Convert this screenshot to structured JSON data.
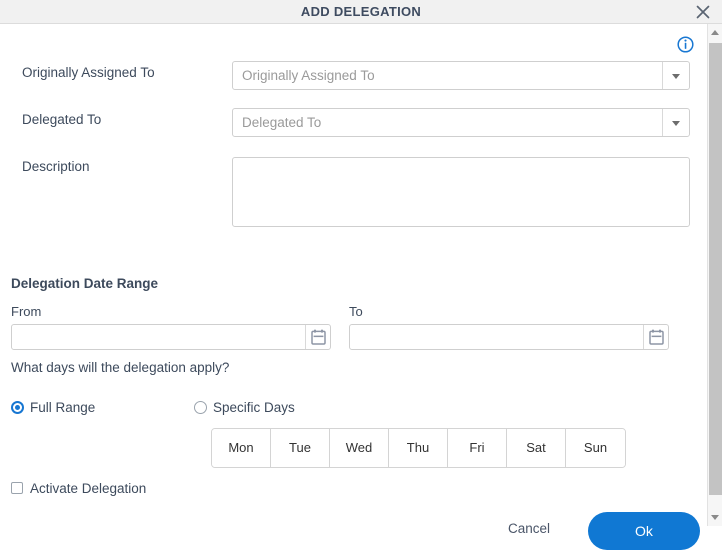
{
  "titlebar": {
    "title": "ADD DELEGATION",
    "close_icon": "close-icon"
  },
  "icons": {
    "info": "info-icon",
    "calendar": "calendar-icon",
    "chevron_down": "chevron-down-icon",
    "scroll_up": "scroll-up-arrow-icon",
    "scroll_down": "scroll-down-arrow-icon"
  },
  "form": {
    "originally_assigned_to": {
      "label": "Originally Assigned To",
      "placeholder": "Originally Assigned To",
      "value": ""
    },
    "delegated_to": {
      "label": "Delegated To",
      "placeholder": "Delegated To",
      "value": ""
    },
    "description": {
      "label": "Description",
      "placeholder": "",
      "value": ""
    }
  },
  "date_range": {
    "heading": "Delegation Date Range",
    "from": {
      "label": "From",
      "value": "",
      "placeholder": ""
    },
    "to": {
      "label": "To",
      "value": "",
      "placeholder": ""
    }
  },
  "days_question": "What days will the delegation apply?",
  "range_options": [
    {
      "label": "Full Range",
      "selected": true
    },
    {
      "label": "Specific Days",
      "selected": false
    }
  ],
  "days": [
    {
      "label": "Mon",
      "selected": false
    },
    {
      "label": "Tue",
      "selected": false
    },
    {
      "label": "Wed",
      "selected": false
    },
    {
      "label": "Thu",
      "selected": false
    },
    {
      "label": "Fri",
      "selected": false
    },
    {
      "label": "Sat",
      "selected": false
    },
    {
      "label": "Sun",
      "selected": false
    }
  ],
  "activate": {
    "label": "Activate Delegation",
    "checked": false
  },
  "footer": {
    "cancel_label": "Cancel",
    "ok_label": "Ok"
  },
  "colors": {
    "accent": "#1078d3",
    "titlebar_bg": "#f1f1f1",
    "label_text": "#3d4a5c",
    "placeholder_text": "#9a9a9a",
    "border": "#cfcfcf",
    "scrollbar_thumb": "#c3c3c3"
  }
}
